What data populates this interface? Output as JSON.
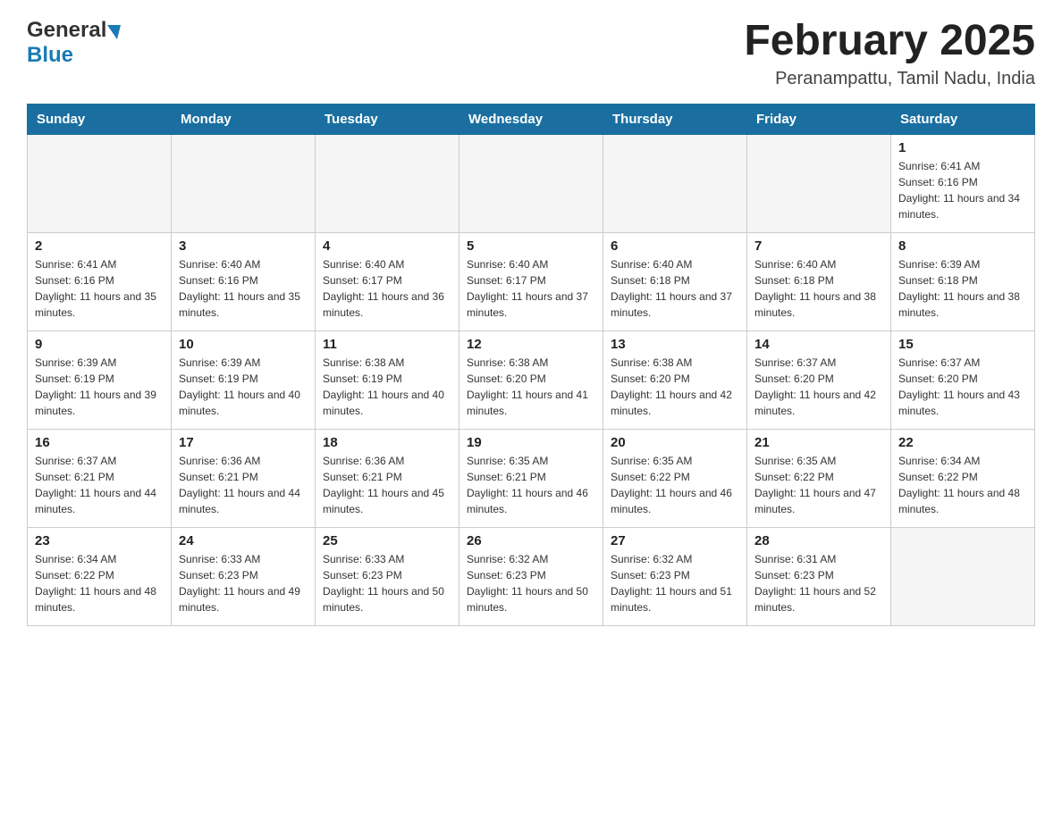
{
  "header": {
    "logo_general": "General",
    "logo_blue": "Blue",
    "month_title": "February 2025",
    "location": "Peranampattu, Tamil Nadu, India"
  },
  "days_of_week": [
    "Sunday",
    "Monday",
    "Tuesday",
    "Wednesday",
    "Thursday",
    "Friday",
    "Saturday"
  ],
  "weeks": [
    [
      {
        "day": "",
        "info": ""
      },
      {
        "day": "",
        "info": ""
      },
      {
        "day": "",
        "info": ""
      },
      {
        "day": "",
        "info": ""
      },
      {
        "day": "",
        "info": ""
      },
      {
        "day": "",
        "info": ""
      },
      {
        "day": "1",
        "info": "Sunrise: 6:41 AM\nSunset: 6:16 PM\nDaylight: 11 hours and 34 minutes."
      }
    ],
    [
      {
        "day": "2",
        "info": "Sunrise: 6:41 AM\nSunset: 6:16 PM\nDaylight: 11 hours and 35 minutes."
      },
      {
        "day": "3",
        "info": "Sunrise: 6:40 AM\nSunset: 6:16 PM\nDaylight: 11 hours and 35 minutes."
      },
      {
        "day": "4",
        "info": "Sunrise: 6:40 AM\nSunset: 6:17 PM\nDaylight: 11 hours and 36 minutes."
      },
      {
        "day": "5",
        "info": "Sunrise: 6:40 AM\nSunset: 6:17 PM\nDaylight: 11 hours and 37 minutes."
      },
      {
        "day": "6",
        "info": "Sunrise: 6:40 AM\nSunset: 6:18 PM\nDaylight: 11 hours and 37 minutes."
      },
      {
        "day": "7",
        "info": "Sunrise: 6:40 AM\nSunset: 6:18 PM\nDaylight: 11 hours and 38 minutes."
      },
      {
        "day": "8",
        "info": "Sunrise: 6:39 AM\nSunset: 6:18 PM\nDaylight: 11 hours and 38 minutes."
      }
    ],
    [
      {
        "day": "9",
        "info": "Sunrise: 6:39 AM\nSunset: 6:19 PM\nDaylight: 11 hours and 39 minutes."
      },
      {
        "day": "10",
        "info": "Sunrise: 6:39 AM\nSunset: 6:19 PM\nDaylight: 11 hours and 40 minutes."
      },
      {
        "day": "11",
        "info": "Sunrise: 6:38 AM\nSunset: 6:19 PM\nDaylight: 11 hours and 40 minutes."
      },
      {
        "day": "12",
        "info": "Sunrise: 6:38 AM\nSunset: 6:20 PM\nDaylight: 11 hours and 41 minutes."
      },
      {
        "day": "13",
        "info": "Sunrise: 6:38 AM\nSunset: 6:20 PM\nDaylight: 11 hours and 42 minutes."
      },
      {
        "day": "14",
        "info": "Sunrise: 6:37 AM\nSunset: 6:20 PM\nDaylight: 11 hours and 42 minutes."
      },
      {
        "day": "15",
        "info": "Sunrise: 6:37 AM\nSunset: 6:20 PM\nDaylight: 11 hours and 43 minutes."
      }
    ],
    [
      {
        "day": "16",
        "info": "Sunrise: 6:37 AM\nSunset: 6:21 PM\nDaylight: 11 hours and 44 minutes."
      },
      {
        "day": "17",
        "info": "Sunrise: 6:36 AM\nSunset: 6:21 PM\nDaylight: 11 hours and 44 minutes."
      },
      {
        "day": "18",
        "info": "Sunrise: 6:36 AM\nSunset: 6:21 PM\nDaylight: 11 hours and 45 minutes."
      },
      {
        "day": "19",
        "info": "Sunrise: 6:35 AM\nSunset: 6:21 PM\nDaylight: 11 hours and 46 minutes."
      },
      {
        "day": "20",
        "info": "Sunrise: 6:35 AM\nSunset: 6:22 PM\nDaylight: 11 hours and 46 minutes."
      },
      {
        "day": "21",
        "info": "Sunrise: 6:35 AM\nSunset: 6:22 PM\nDaylight: 11 hours and 47 minutes."
      },
      {
        "day": "22",
        "info": "Sunrise: 6:34 AM\nSunset: 6:22 PM\nDaylight: 11 hours and 48 minutes."
      }
    ],
    [
      {
        "day": "23",
        "info": "Sunrise: 6:34 AM\nSunset: 6:22 PM\nDaylight: 11 hours and 48 minutes."
      },
      {
        "day": "24",
        "info": "Sunrise: 6:33 AM\nSunset: 6:23 PM\nDaylight: 11 hours and 49 minutes."
      },
      {
        "day": "25",
        "info": "Sunrise: 6:33 AM\nSunset: 6:23 PM\nDaylight: 11 hours and 50 minutes."
      },
      {
        "day": "26",
        "info": "Sunrise: 6:32 AM\nSunset: 6:23 PM\nDaylight: 11 hours and 50 minutes."
      },
      {
        "day": "27",
        "info": "Sunrise: 6:32 AM\nSunset: 6:23 PM\nDaylight: 11 hours and 51 minutes."
      },
      {
        "day": "28",
        "info": "Sunrise: 6:31 AM\nSunset: 6:23 PM\nDaylight: 11 hours and 52 minutes."
      },
      {
        "day": "",
        "info": ""
      }
    ]
  ]
}
